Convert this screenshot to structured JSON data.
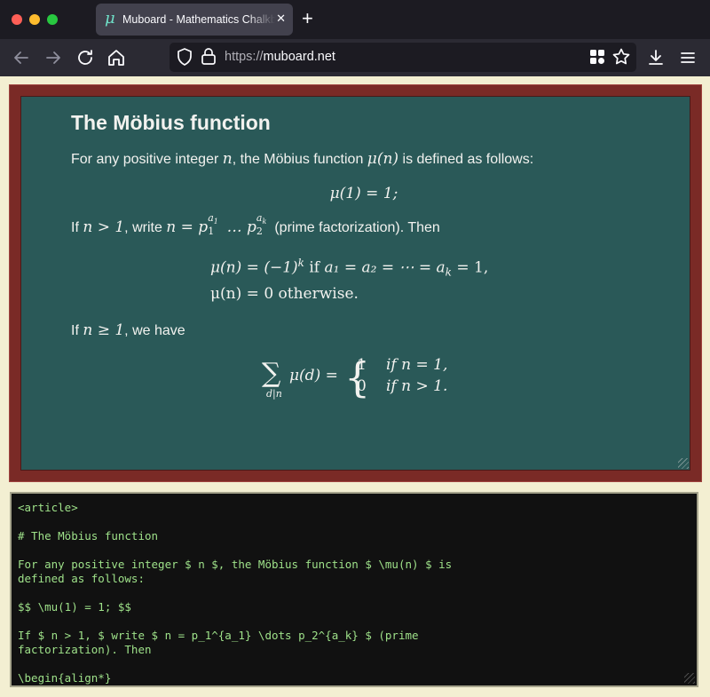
{
  "window": {
    "tab_title": "Muboard - Mathematics Chalkboard",
    "tab_favicon": "μ",
    "tab_close": "✕",
    "new_tab": "+"
  },
  "toolbar": {
    "url_scheme": "https://",
    "url_host": "muboard.net",
    "icons": [
      "back-arrow-icon",
      "forward-arrow-icon",
      "reload-icon",
      "home-icon",
      "shield-icon",
      "lock-icon",
      "extensions-grid-icon",
      "star-icon",
      "download-icon",
      "menu-icon"
    ]
  },
  "board": {
    "title": "The Möbius function",
    "p1": {
      "text_a": "For any positive integer ",
      "n": "n",
      "text_b": ", the Möbius function ",
      "mu_n": "μ(n)",
      "text_c": " is defined as follows:"
    },
    "eq1": "μ(1) = 1;",
    "p2": {
      "text_a": "If ",
      "cond": "n > 1",
      "text_b": ", write ",
      "expr_lhs": "n = p",
      "sub1": "1",
      "sup1": "a",
      "sup1_sub": "1",
      "dots": " … p",
      "sub2": "2",
      "sup2": "a",
      "sup2_sub": "k",
      "text_c": " (prime factorization). Then"
    },
    "align": {
      "line1_lhs": "μ(n) = (−1)",
      "line1_exp": "k",
      "line1_if": " if ",
      "line1_rhs": "a₁ = a₂ = ⋯ = a",
      "line1_rhs_sub": "k",
      "line1_end": " = 1,",
      "line2": "μ(n) = 0 otherwise."
    },
    "p3": {
      "text_a": "If ",
      "cond": "n ≥ 1",
      "text_b": ", we have"
    },
    "sum": {
      "sigma": "∑",
      "under": "d|n",
      "lhs": "μ(d) =",
      "case1_val": "1",
      "case1_cond": "if n = 1,",
      "case2_val": "0",
      "case2_cond": "if n > 1."
    }
  },
  "editor": {
    "source": "<article>\n\n# The Möbius function\n\nFor any positive integer $ n $, the Möbius function $ \\mu(n) $ is\ndefined as follows:\n\n$$ \\mu(1) = 1; $$\n\nIf $ n > 1, $ write $ n = p_1^{a_1} \\dots p_2^{a_k} $ (prime\nfactorization). Then\n\n\\begin{align*}"
  },
  "colors": {
    "board": "#2a5958",
    "frame": "#7a2a26",
    "page_bg": "#f3efd2",
    "editor_text": "#9fe28a"
  }
}
